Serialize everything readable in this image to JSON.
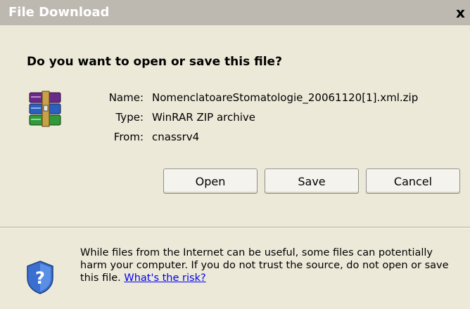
{
  "window": {
    "title": "File Download",
    "close_glyph": "x"
  },
  "dialog": {
    "question": "Do you want to open or save this file?",
    "file_icon": "winrar-archive-icon",
    "fields": [
      {
        "label": "Name:",
        "value": "NomenclatoareStomatologie_20061120[1].xml.zip"
      },
      {
        "label": "Type:",
        "value": "WinRAR ZIP archive"
      },
      {
        "label": "From:",
        "value": "cnassrv4"
      }
    ],
    "buttons": {
      "open": "Open",
      "save": "Save",
      "cancel": "Cancel"
    }
  },
  "warning": {
    "icon": "security-shield-icon",
    "text": "While files from the Internet can be useful, some files can potentially harm your computer. If you do not trust the source, do not open or save this file.",
    "link": "What's the risk?"
  },
  "colors": {
    "titlebar": "#bdb9b0",
    "background": "#ece9d8",
    "link": "#0000ee"
  }
}
